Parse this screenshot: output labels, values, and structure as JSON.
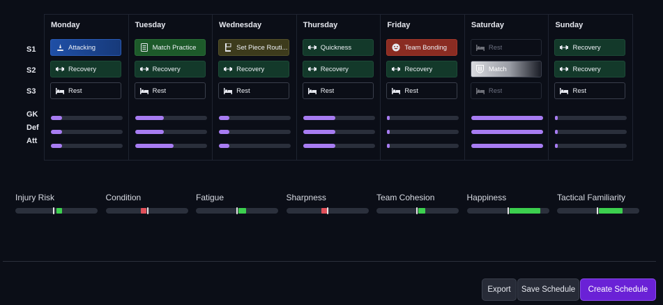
{
  "rows": {
    "s1": "S1",
    "s2": "S2",
    "s3": "S3",
    "gk": "GK",
    "def": "Def",
    "att": "Att"
  },
  "days": [
    {
      "name": "Monday",
      "sessions": [
        {
          "label": "Attacking",
          "type": "attacking",
          "icon": "attacking-icon"
        },
        {
          "label": "Recovery",
          "type": "recovery",
          "icon": "dumbbell-icon"
        },
        {
          "label": "Rest",
          "type": "rest",
          "icon": "bed-icon"
        }
      ],
      "intensity": {
        "gk": 0.16,
        "def": 0.16,
        "att": 0.16
      }
    },
    {
      "name": "Tuesday",
      "sessions": [
        {
          "label": "Match Practice",
          "type": "match-practice",
          "icon": "clipboard-icon"
        },
        {
          "label": "Recovery",
          "type": "recovery",
          "icon": "dumbbell-icon"
        },
        {
          "label": "Rest",
          "type": "rest",
          "icon": "bed-icon"
        }
      ],
      "intensity": {
        "gk": 0.4,
        "def": 0.4,
        "att": 0.53
      }
    },
    {
      "name": "Wednesday",
      "sessions": [
        {
          "label": "Set Piece Routi...",
          "type": "set-piece",
          "icon": "flag-icon"
        },
        {
          "label": "Recovery",
          "type": "recovery",
          "icon": "dumbbell-icon"
        },
        {
          "label": "Rest",
          "type": "rest",
          "icon": "bed-icon"
        }
      ],
      "intensity": {
        "gk": 0.15,
        "def": 0.15,
        "att": 0.15
      }
    },
    {
      "name": "Thursday",
      "sessions": [
        {
          "label": "Quickness",
          "type": "quickness",
          "icon": "dumbbell-icon"
        },
        {
          "label": "Recovery",
          "type": "recovery",
          "icon": "dumbbell-icon"
        },
        {
          "label": "Rest",
          "type": "rest",
          "icon": "bed-icon"
        }
      ],
      "intensity": {
        "gk": 0.45,
        "def": 0.45,
        "att": 0.45
      }
    },
    {
      "name": "Friday",
      "sessions": [
        {
          "label": "Team Bonding",
          "type": "team-bonding",
          "icon": "smile-icon"
        },
        {
          "label": "Recovery",
          "type": "recovery",
          "icon": "dumbbell-icon"
        },
        {
          "label": "Rest",
          "type": "rest",
          "icon": "bed-icon"
        }
      ],
      "intensity": {
        "gk": 0.03,
        "def": 0.03,
        "att": 0.03
      }
    },
    {
      "name": "Saturday",
      "sessions": [
        {
          "label": "Rest",
          "type": "rest",
          "icon": "bed-icon",
          "dim": true
        },
        {
          "label": "Match",
          "type": "match",
          "icon": "shield-icon"
        },
        {
          "label": "Rest",
          "type": "rest",
          "icon": "bed-icon",
          "dim": true
        }
      ],
      "intensity": {
        "gk": 1.0,
        "def": 1.0,
        "att": 1.0
      }
    },
    {
      "name": "Sunday",
      "sessions": [
        {
          "label": "Recovery",
          "type": "recovery",
          "icon": "dumbbell-icon"
        },
        {
          "label": "Recovery",
          "type": "recovery",
          "icon": "dumbbell-icon"
        },
        {
          "label": "Rest",
          "type": "rest",
          "icon": "bed-icon"
        }
      ],
      "intensity": {
        "gk": 0.02,
        "def": 0.02,
        "att": 0.02
      }
    }
  ],
  "metrics": [
    {
      "name": "Injury Risk",
      "marker": 0.47,
      "from": 0.5,
      "to": 0.57,
      "color": "#3ccf4e"
    },
    {
      "name": "Condition",
      "marker": 0.51,
      "from": 0.43,
      "to": 0.5,
      "color": "#e0505a"
    },
    {
      "name": "Fatigue",
      "marker": 0.5,
      "from": 0.52,
      "to": 0.61,
      "color": "#3ccf4e"
    },
    {
      "name": "Sharpness",
      "marker": 0.5,
      "from": 0.43,
      "to": 0.5,
      "color": "#e0505a"
    },
    {
      "name": "Team Cohesion",
      "marker": 0.49,
      "from": 0.51,
      "to": 0.59,
      "color": "#3ccf4e"
    },
    {
      "name": "Happiness",
      "marker": 0.5,
      "from": 0.52,
      "to": 0.89,
      "color": "#3ccf4e"
    },
    {
      "name": "Tactical Familiarity",
      "marker": 0.49,
      "from": 0.51,
      "to": 0.8,
      "color": "#3ccf4e"
    }
  ],
  "footer": {
    "export": "Export",
    "save": "Save Schedule",
    "create": "Create Schedule"
  },
  "colors": {
    "accent": "#6a21d6",
    "intensity": "#a77cf2",
    "positive": "#3ccf4e",
    "negative": "#e0505a"
  }
}
